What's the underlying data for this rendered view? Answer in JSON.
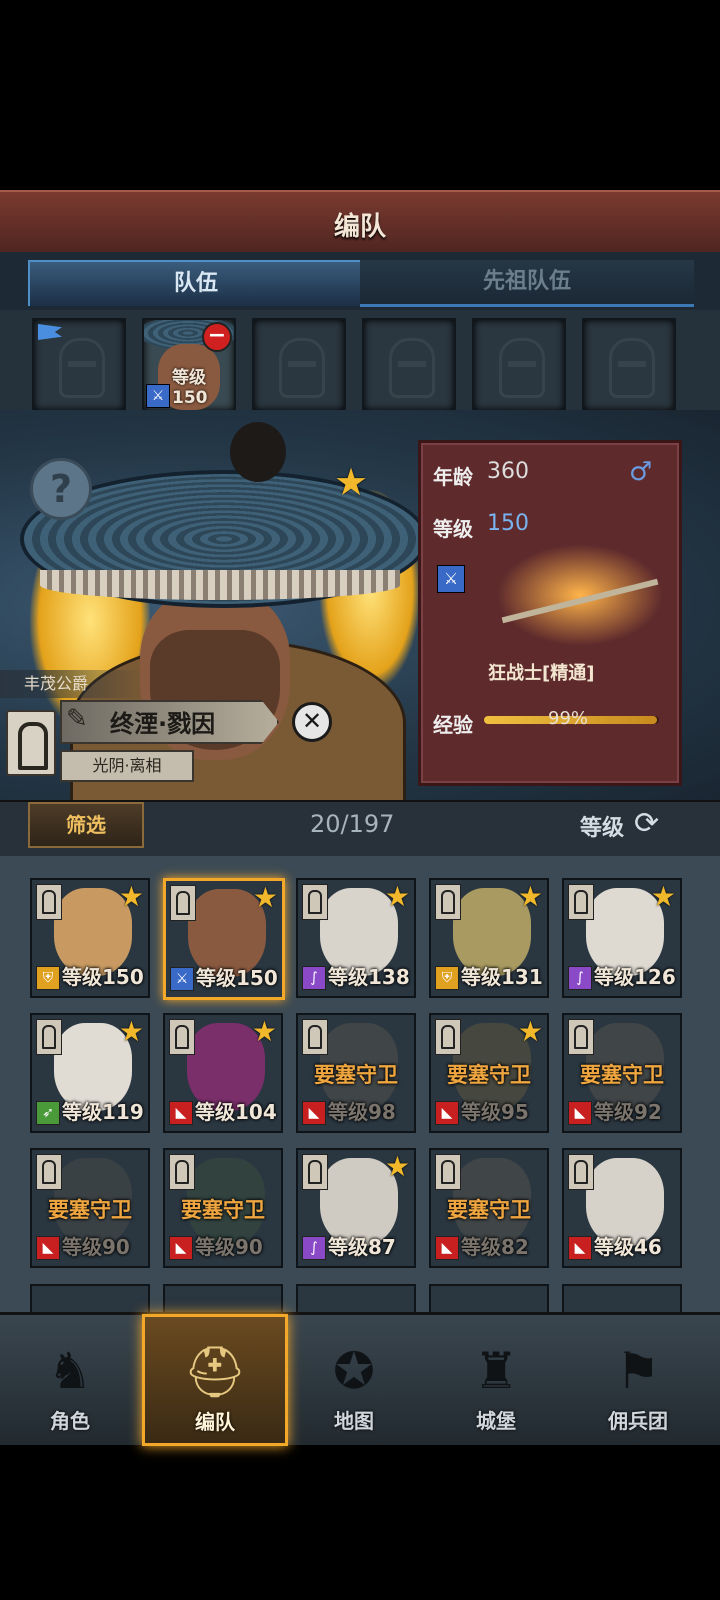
{
  "header": {
    "title": "编队"
  },
  "tabs": [
    {
      "label": "队伍",
      "active": true
    },
    {
      "label": "先祖队伍",
      "active": false
    }
  ],
  "team_slots": [
    {
      "filled": false,
      "flag": true
    },
    {
      "filled": true,
      "level": "等级150",
      "remove_icon": "minus-circle-icon"
    },
    {
      "filled": false
    },
    {
      "filled": false
    },
    {
      "filled": false
    },
    {
      "filled": false
    }
  ],
  "hero": {
    "title": "丰茂公爵",
    "name": "终湮·戮因",
    "sub": "光阴·离相",
    "age_label": "年龄",
    "age": "360",
    "gender_icon": "male-icon",
    "level_label": "等级",
    "level": "150",
    "class_name": "狂战士[精通]",
    "exp_label": "经验",
    "exp": "99%"
  },
  "filter": {
    "button": "筛选",
    "count": "20/197",
    "sort_label": "等级"
  },
  "roster": [
    {
      "level": "等级150",
      "class": "shield",
      "star": true,
      "locked": false,
      "selected": false,
      "face": "#c89a62"
    },
    {
      "level": "等级150",
      "class": "sword",
      "star": true,
      "locked": false,
      "selected": true,
      "face": "#8a5a40"
    },
    {
      "level": "等级138",
      "class": "staff",
      "star": true,
      "locked": false,
      "selected": false,
      "face": "#d8d4cc"
    },
    {
      "level": "等级131",
      "class": "shield",
      "star": true,
      "locked": false,
      "selected": false,
      "face": "#a89a60"
    },
    {
      "level": "等级126",
      "class": "staff",
      "star": true,
      "locked": false,
      "selected": false,
      "face": "#dedad2"
    },
    {
      "level": "等级119",
      "class": "bow",
      "star": true,
      "locked": false,
      "selected": false,
      "face": "#e0dcd4"
    },
    {
      "level": "等级104",
      "class": "beast",
      "star": true,
      "locked": false,
      "selected": false,
      "face": "#7a2e6a"
    },
    {
      "level": "等级98",
      "class": "beast",
      "star": false,
      "locked": true,
      "lock_text": "要塞守卫",
      "face": "#6a6056"
    },
    {
      "level": "等级95",
      "class": "beast",
      "star": true,
      "locked": true,
      "lock_text": "要塞守卫",
      "face": "#7a6a40"
    },
    {
      "level": "等级92",
      "class": "beast",
      "star": false,
      "locked": true,
      "lock_text": "要塞守卫",
      "face": "#6a6056"
    },
    {
      "level": "等级90",
      "class": "beast",
      "star": false,
      "locked": true,
      "lock_text": "要塞守卫",
      "face": "#5a5650"
    },
    {
      "level": "等级90",
      "class": "beast",
      "star": false,
      "locked": true,
      "lock_text": "要塞守卫",
      "face": "#3e5a40"
    },
    {
      "level": "等级87",
      "class": "staff",
      "star": true,
      "locked": false,
      "selected": false,
      "face": "#cfcbc2"
    },
    {
      "level": "等级82",
      "class": "beast",
      "star": false,
      "locked": true,
      "lock_text": "要塞守卫",
      "face": "#6a6056"
    },
    {
      "level": "等级46",
      "class": "beast",
      "star": false,
      "locked": false,
      "selected": false,
      "face": "#d6d2ca"
    }
  ],
  "nav": [
    {
      "label": "角色",
      "icon": "knight-icon",
      "active": false
    },
    {
      "label": "编队",
      "icon": "helmet-icon",
      "active": true
    },
    {
      "label": "地图",
      "icon": "compass-map-icon",
      "active": false
    },
    {
      "label": "城堡",
      "icon": "castle-icon",
      "active": false
    },
    {
      "label": "佣兵团",
      "icon": "mercenary-banner-icon",
      "active": false
    }
  ],
  "colors": {
    "accent": "#f4a82a",
    "tab_blue": "#4f8fc8",
    "card_red": "#5e2a2c"
  }
}
